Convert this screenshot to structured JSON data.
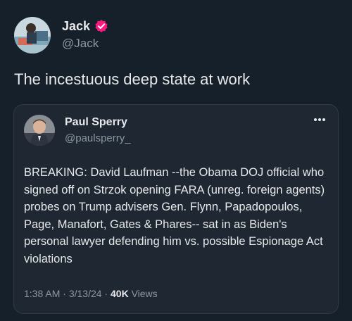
{
  "author": {
    "display_name": "Jack",
    "handle": "@Jack",
    "verified": true,
    "avatar_icon": "profile-photo"
  },
  "tweet": {
    "text": "The incestuous deep state at work"
  },
  "quoted": {
    "display_name": "Paul Sperry",
    "handle": "@paulsperry_",
    "avatar_icon": "profile-photo",
    "more_icon": "more-dots-icon",
    "text": "BREAKING: David Laufman --the Obama DOJ official who signed off on Strzok opening FARA (unreg. foreign agents) probes on Trump advisers Gen. Flynn, Papadopoulos, Page, Manafort, Gates & Phares-- sat in as Biden's personal lawyer defending him vs. possible Espionage Act violations",
    "time": "1:38 AM",
    "date": "3/13/24",
    "separator": " · ",
    "views_count": "40K",
    "views_label": " Views"
  },
  "colors": {
    "background": "#15202b",
    "card": "#1e2732",
    "text_primary": "#e7e9ea",
    "text_secondary": "#8b98a5",
    "verified_badge": "#f91880"
  }
}
